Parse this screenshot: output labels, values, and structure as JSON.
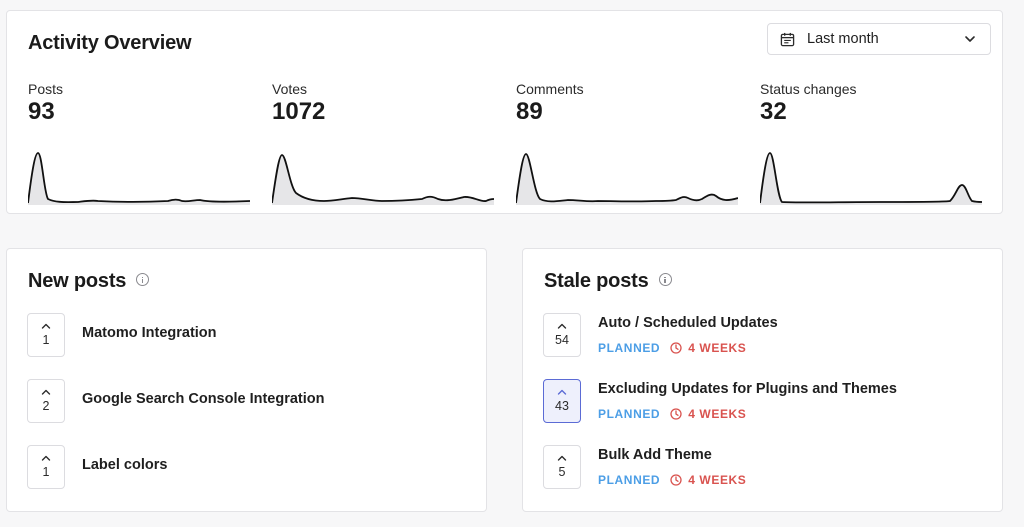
{
  "overview": {
    "title": "Activity Overview",
    "range_label": "Last month",
    "metrics": [
      {
        "label": "Posts",
        "value": "93"
      },
      {
        "label": "Votes",
        "value": "1072"
      },
      {
        "label": "Comments",
        "value": "89"
      },
      {
        "label": "Status changes",
        "value": "32"
      }
    ]
  },
  "new_posts": {
    "title": "New posts",
    "items": [
      {
        "votes": "1",
        "title": "Matomo Integration"
      },
      {
        "votes": "2",
        "title": "Google Search Console Integration"
      },
      {
        "votes": "1",
        "title": "Label colors"
      }
    ]
  },
  "stale_posts": {
    "title": "Stale posts",
    "items": [
      {
        "votes": "54",
        "title": "Auto / Scheduled Updates",
        "status": "PLANNED",
        "age": "4 WEEKS",
        "selected": false
      },
      {
        "votes": "43",
        "title": "Excluding Updates for Plugins and Themes",
        "status": "PLANNED",
        "age": "4 WEEKS",
        "selected": true
      },
      {
        "votes": "5",
        "title": "Bulk Add Theme",
        "status": "PLANNED",
        "age": "4 WEEKS",
        "selected": false
      }
    ]
  },
  "colors": {
    "status_planned": "#4c9ee6",
    "age_warning": "#d9534f",
    "selected_vote_border": "#5b6bd5"
  }
}
